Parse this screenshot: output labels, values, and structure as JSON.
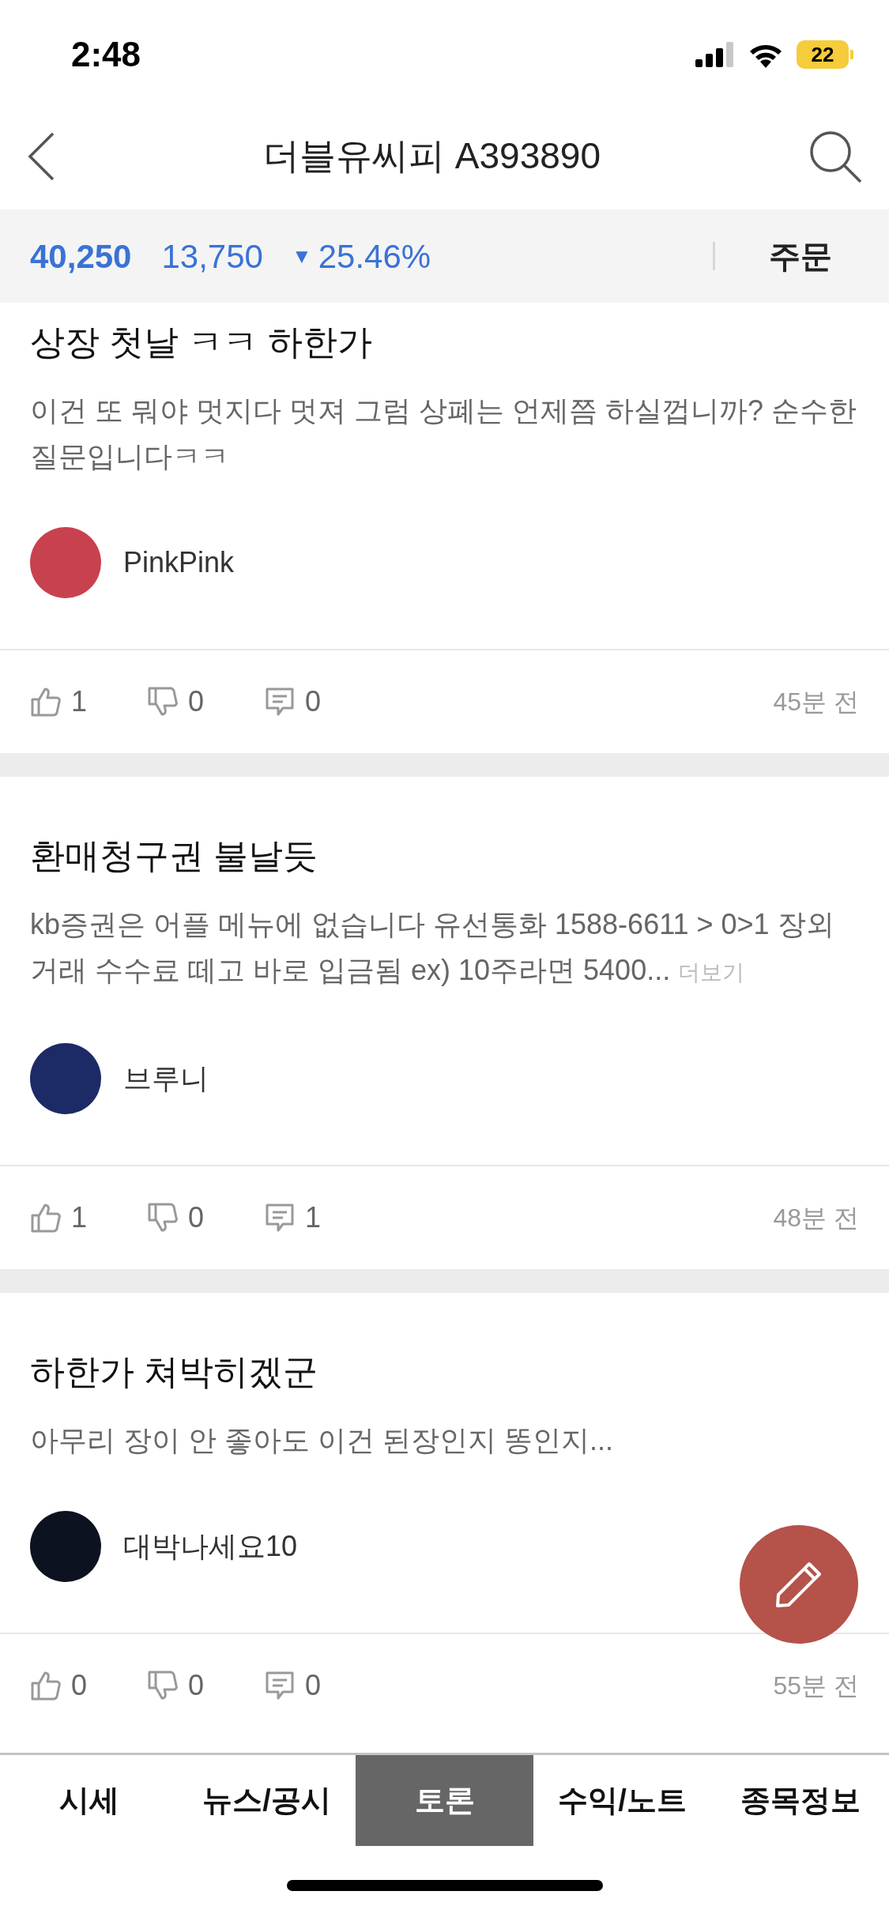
{
  "status_bar": {
    "time": "2:48",
    "battery": "22"
  },
  "header": {
    "title": "더블유씨피 A393890"
  },
  "price_bar": {
    "price": "40,250",
    "change": "13,750",
    "change_icon": "▼",
    "rate": "25.46%",
    "order_button": "주문"
  },
  "posts": [
    {
      "title": "상장 첫날 ㅋㅋ 하한가",
      "body": "이건 또 뭐야 멋지다 멋져 그럼 상폐는 언제쯤 하실껍니까?  순수한 질문입니다ㅋㅋ",
      "author": {
        "name": "PinkPink",
        "color": "#c8414f"
      },
      "likes": "1",
      "dislikes": "0",
      "comments": "0",
      "time": "45분 전"
    },
    {
      "title": "환매청구권 불날듯",
      "body": "kb증권은 어플 메뉴에 없습니다  유선통화 1588-6611 > 0>1 장외거래 수수료 떼고 바로 입금됨 ex) 10주라면 5400...",
      "more": "더보기",
      "author": {
        "name": "브루니",
        "color": "#1c2a66"
      },
      "likes": "1",
      "dislikes": "0",
      "comments": "1",
      "time": "48분 전"
    },
    {
      "title": "하한가 쳐박히겠군",
      "body": "아무리 장이 안 좋아도 이건 된장인지 똥인지...",
      "author": {
        "name": "대박나세요10",
        "color": "#0d1220"
      },
      "likes": "0",
      "dislikes": "0",
      "comments": "0",
      "time": "55분 전"
    }
  ],
  "tabs": [
    {
      "label": "시세",
      "selected": false
    },
    {
      "label": "뉴스/공시",
      "selected": false
    },
    {
      "label": "토론",
      "selected": true
    },
    {
      "label": "수익/노트",
      "selected": false
    },
    {
      "label": "종목정보",
      "selected": false
    }
  ]
}
